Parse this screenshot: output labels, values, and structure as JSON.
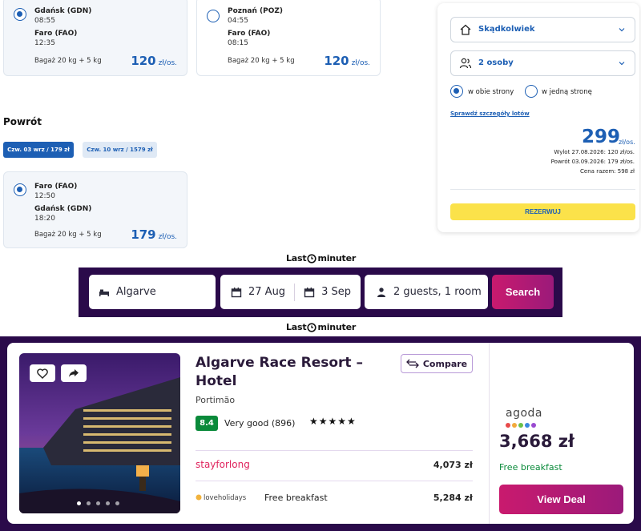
{
  "outbound": {
    "options": [
      {
        "selected": true,
        "from_city": "Gdańsk (GDN)",
        "from_time": "08:55",
        "to_city": "Faro (FAO)",
        "to_time": "12:35",
        "baggage": "Bagaż 20 kg + 5 kg",
        "price": "120",
        "price_unit": "zł/os."
      },
      {
        "selected": false,
        "from_city": "Poznań (POZ)",
        "from_time": "04:55",
        "to_city": "Faro (FAO)",
        "to_time": "08:15",
        "baggage": "Bagaż 20 kg + 5 kg",
        "price": "120",
        "price_unit": "zł/os."
      }
    ]
  },
  "return": {
    "title": "Powrót",
    "date_tabs": [
      {
        "label": "Czw. 03 wrz / 179 zł",
        "active": true
      },
      {
        "label": "Czw. 10 wrz / 1579 zł",
        "active": false
      }
    ],
    "option": {
      "selected": true,
      "from_city": "Faro (FAO)",
      "from_time": "12:50",
      "to_city": "Gdańsk (GDN)",
      "to_time": "18:20",
      "baggage": "Bagaż 20 kg + 5 kg",
      "price": "179",
      "price_unit": "zł/os."
    }
  },
  "booking_panel": {
    "origin_select": "Skądkolwiek",
    "people_select": "2 osoby",
    "trip_types": [
      {
        "label": "w obie strony",
        "selected": true
      },
      {
        "label": "w jedną stronę",
        "selected": false
      }
    ],
    "details_link": "Sprawdź szczegóły lotów",
    "price": "299",
    "price_unit": "zł/os.",
    "outbound_line": "Wylot 27.08.2026: 120 zł/os.",
    "return_line": "Powrót 03.09.2026: 179 zł/os.",
    "total_line": "Cena razem: 598 zł",
    "book_button": "REZERWUJ"
  },
  "brand": {
    "logo_left": "Last",
    "logo_right": "minuter"
  },
  "search": {
    "destination": "Algarve",
    "checkin": "27 Aug",
    "checkout": "3 Sep",
    "guests": "2 guests, 1 room",
    "button": "Search"
  },
  "hotel": {
    "name": "Algarve Race Resort – Hotel",
    "location": "Portimão",
    "rating_score": "8.4",
    "rating_text": "Very good (896)",
    "stars": "★★★★★",
    "compare_label": "Compare",
    "photo_count": 5,
    "providers": [
      {
        "name": "stayforlong",
        "note": "",
        "price": "4,073 zł"
      },
      {
        "name": "loveholidays",
        "note": "Free breakfast",
        "price": "5,284 zł"
      }
    ],
    "best_deal": {
      "provider": "agoda",
      "price": "3,668 zł",
      "note": "Free breakfast",
      "button": "View Deal"
    }
  },
  "colors": {
    "primary_blue": "#1d5fb4",
    "accent_yellow": "#fbe24a",
    "brand_purple": "#2a0a4a",
    "brand_pink": "#c91a6e",
    "rating_green": "#0a8a3a"
  }
}
